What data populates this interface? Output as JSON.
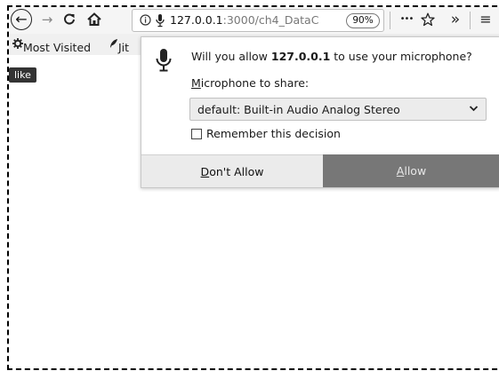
{
  "toolbar": {
    "back_glyph": "←",
    "forward_glyph": "→",
    "reload_glyph": "C",
    "home_glyph": "⌂",
    "url_host": "127.0.0.1",
    "url_rest": ":3000/ch4_DataC",
    "zoom": "90%",
    "more_glyph": "•••",
    "overflow_glyph": "»",
    "menu_glyph": "≡",
    "icons": [
      "back-icon",
      "forward-icon",
      "reload-icon",
      "home-icon",
      "info-icon",
      "microphone-icon",
      "bookmark-star-icon",
      "menu-icon"
    ]
  },
  "bookmarks": {
    "most_visited": "Most Visited",
    "jit": "Jit"
  },
  "page": {
    "tooltip": "like"
  },
  "permission_prompt": {
    "question_prefix": "Will you allow ",
    "question_host": "127.0.0.1",
    "question_suffix": " to use your microphone?",
    "share_label_underlined": "M",
    "share_label_rest": "icrophone to share:",
    "selected_device": "default: Built-in Audio Analog Stereo",
    "remember_label": "Remember this decision",
    "remember_checked": false,
    "deny_underlined": "D",
    "deny_rest": "on't Allow",
    "allow_underlined": "A",
    "allow_rest": "llow"
  },
  "colors": {
    "allow_button_bg": "#777777",
    "deny_button_bg": "#ebebeb",
    "toolbar_bg": "#f5f5f5"
  }
}
